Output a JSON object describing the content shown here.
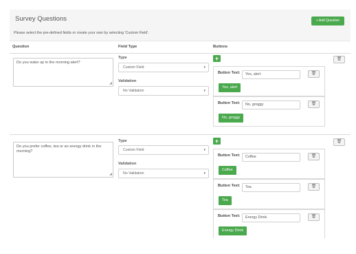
{
  "header": {
    "title": "Survey Questions",
    "subtitle": "Please select the pre-defined fields or create your own by selecting 'Custom Field'.",
    "add_question_label": "+ Add Question"
  },
  "columns": {
    "question": "Question",
    "field_type": "Field Type",
    "buttons": "Buttons"
  },
  "questions": [
    {
      "text": "Do you wake up in the morning alert?",
      "type_label": "Type",
      "type_value": "Custom Field",
      "validation_label": "Validation",
      "validation_value": "No Validation",
      "buttons": [
        {
          "label": "Button Text:",
          "value": "Yes, alert",
          "preview": "Yes, alert"
        },
        {
          "label": "Button Text:",
          "value": "No, groggy",
          "preview": "No, groggy"
        }
      ]
    },
    {
      "text": "Do you prefer coffee, tea or an energy drink in the morning?",
      "type_label": "Type",
      "type_value": "Custom Field",
      "validation_label": "Validation",
      "validation_value": "No Validation",
      "buttons": [
        {
          "label": "Button Text:",
          "value": "Coffee",
          "preview": "Coffee"
        },
        {
          "label": "Button Text:",
          "value": "Tea",
          "preview": "Tea"
        },
        {
          "label": "Button Text:",
          "value": "Energy Drink",
          "preview": "Energy Drink"
        }
      ]
    }
  ],
  "icons": {
    "plus": "+",
    "trash": "🗑",
    "caret": "▾",
    "resize": "◢"
  },
  "colors": {
    "green": "#4aa84d",
    "header_bg": "#f5f5f5"
  }
}
